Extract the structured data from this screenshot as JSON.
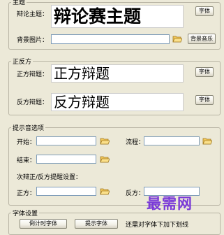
{
  "topic": {
    "group_label": "主题",
    "title_label": "辩论主题：",
    "title_value": "辩论赛主题",
    "font_button": "字体",
    "bg_label": "背景图片：",
    "bg_value": "",
    "music_button": "背景音乐"
  },
  "sides": {
    "group_label": "正反方",
    "pro_label": "正方辩题：",
    "pro_value": "正方辩题",
    "pro_font_button": "字体",
    "con_label": "反方辩题：",
    "con_value": "反方辩题",
    "con_font_button": "字体"
  },
  "prompts": {
    "group_label": "提示音选项",
    "start_label": "开始：",
    "flow_label": "流程：",
    "end_label": "结束：",
    "remaining_label": "次辩正/反方提醒设置：",
    "pro_label": "正方：",
    "con_label": "反方："
  },
  "font_settings": {
    "group_label": "字体设置",
    "btn1": "倒计时字体 ",
    "btn2": "提示字体 ",
    "note": "还需对字体下加下划线"
  },
  "watermark": "最需网",
  "icons": {
    "folder": "folder-open-icon"
  }
}
